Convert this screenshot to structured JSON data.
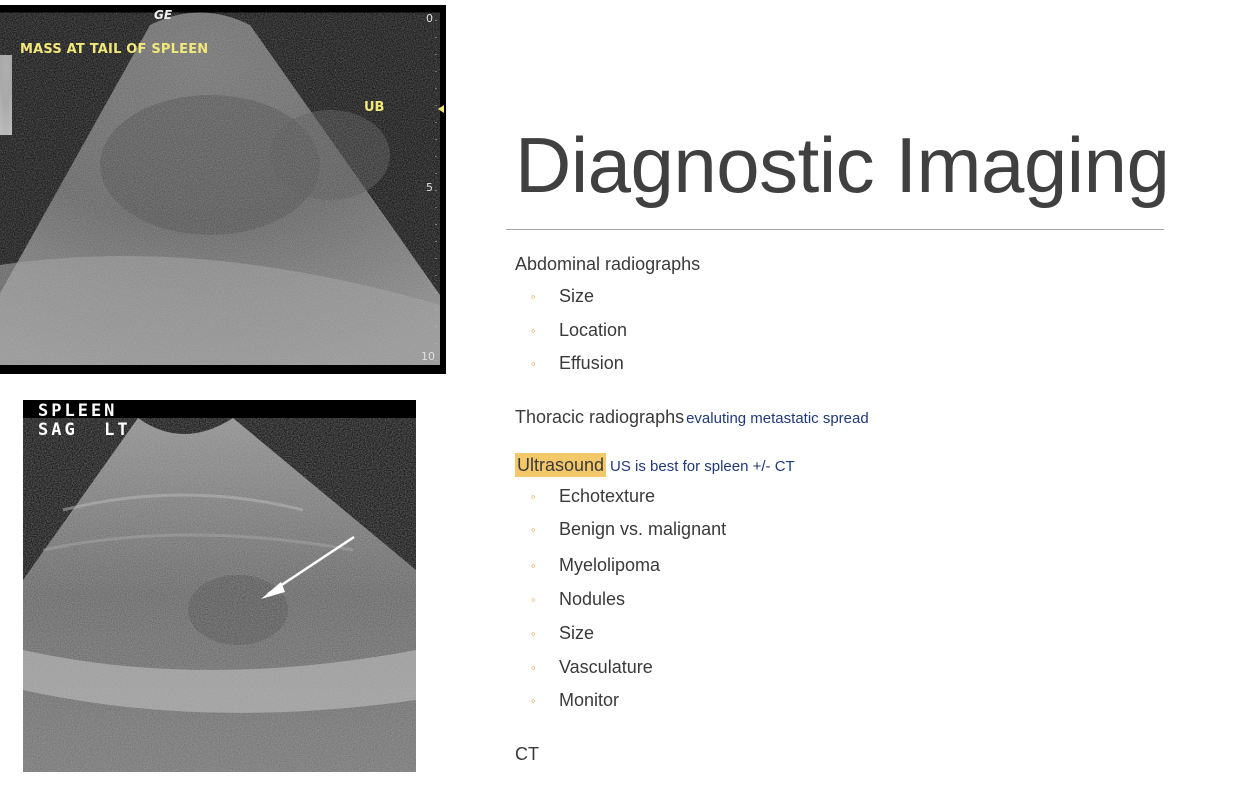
{
  "slide": {
    "title": "Diagnostic Imaging",
    "sections": [
      {
        "heading": "Abdominal radiographs",
        "items": [
          "Size",
          "Location",
          "Effusion"
        ]
      },
      {
        "heading": "Thoracic radiographs",
        "note": "evaluting metastatic spread"
      },
      {
        "heading": "Ultrasound",
        "note": "US is best for spleen +/- CT",
        "highlight_color": "#f3c86a",
        "items": [
          "Echotexture",
          "Benign vs. malignant",
          "Myelolipoma",
          "Nodules",
          "Size",
          "Vasculature",
          "Monitor"
        ]
      },
      {
        "heading": "CT"
      }
    ],
    "bullet_color": "#e8973a",
    "note_color": "#1f3a7a"
  },
  "images": {
    "top": {
      "label": "MASS AT TAIL OF SPLEEN",
      "marker": "UB",
      "logo": "GE",
      "depth_ticks": [
        "0",
        "5",
        "10"
      ]
    },
    "bottom": {
      "label": "SPLEEN\nSAG  LT"
    }
  }
}
